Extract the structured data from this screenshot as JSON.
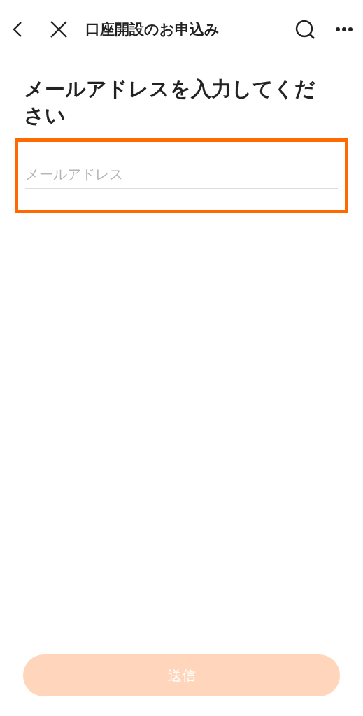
{
  "header": {
    "title": "口座開設のお申込み"
  },
  "heading": "メールアドレスを入力してください",
  "email_field": {
    "placeholder": "メールアドレス",
    "highlighted": true
  },
  "submit_button": {
    "label": "送信",
    "disabled": true
  }
}
